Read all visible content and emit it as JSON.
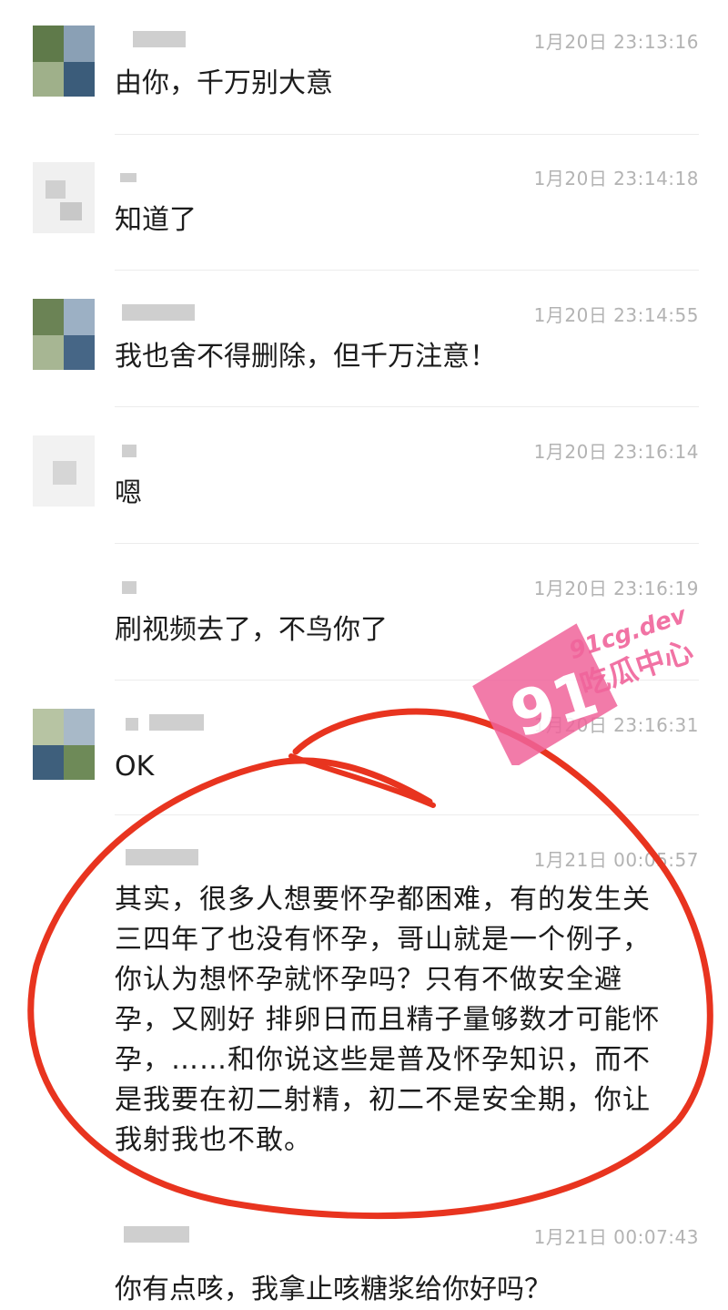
{
  "messages": [
    {
      "time": "1月20日 23:13:16",
      "text": "由你，千万别大意"
    },
    {
      "time": "1月20日 23:14:18",
      "text": "知道了"
    },
    {
      "time": "1月20日 23:14:55",
      "text": "我也舍不得删除，但千万注意！"
    },
    {
      "time": "1月20日 23:16:14",
      "text": "嗯"
    },
    {
      "time": "1月20日 23:16:19",
      "text": "刷视频去了，不鸟你了"
    },
    {
      "time": "1月20日 23:16:31",
      "text": "OK"
    },
    {
      "time": "1月21日 00:05:57",
      "text": "其实，很多人想要怀孕都困难，有的发生关三四年了也没有怀孕，哥山就是一个例子，你认为想怀孕就怀孕吗？只有不做安全避孕，又刚好 排卵日而且精子量够数才可能怀孕，……和你说这些是普及怀孕知识，而不是我要在初二射精，初二不是安全期，你让我射我也不敢。"
    },
    {
      "time": "1月21日 00:07:43",
      "text": "你有点咳，我拿止咳糖浆给你好吗？"
    }
  ],
  "watermark": {
    "logo_text": "91",
    "site": "91cg.dev",
    "name": "吃瓜中心",
    "color": "#f0649b"
  },
  "annotation": {
    "color": "#e8341f"
  }
}
